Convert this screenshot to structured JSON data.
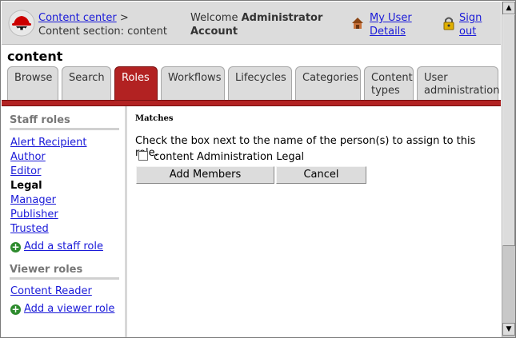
{
  "header": {
    "breadcrumb_link": "Content center",
    "breadcrumb_sep": ">",
    "breadcrumb_section": "Content section: content",
    "welcome_prefix": "Welcome",
    "welcome_user_line1": "Administrator",
    "welcome_user_line2": "Account",
    "my_details_line1": "My User",
    "my_details_line2": "Details",
    "signout_line1": "Sign",
    "signout_line2": "out"
  },
  "page": {
    "title": "content"
  },
  "tabs": [
    {
      "label1": "Browse",
      "label2": ""
    },
    {
      "label1": "Search",
      "label2": ""
    },
    {
      "label1": "Roles",
      "label2": "",
      "active": true
    },
    {
      "label1": "Workflows",
      "label2": ""
    },
    {
      "label1": "Lifecycles",
      "label2": ""
    },
    {
      "label1": "Categories",
      "label2": ""
    },
    {
      "label1": "Content",
      "label2": "types"
    },
    {
      "label1": "User",
      "label2": "administration"
    }
  ],
  "sidebar": {
    "staff_heading": "Staff roles",
    "staff_roles": [
      "Alert Recipient",
      "Author",
      "Editor",
      "Legal",
      "Manager",
      "Publisher",
      "Trusted"
    ],
    "current_role": "Legal",
    "add_staff": "Add a staff role",
    "viewer_heading": "Viewer roles",
    "viewer_roles": [
      "Content Reader"
    ],
    "add_viewer": "Add a viewer role"
  },
  "main": {
    "matches_heading": "Matches",
    "instructions": "Check the box next to the name of the person(s) to assign to this role.",
    "candidate": "content Administration Legal",
    "candidate_checked": false,
    "add_members_label": "Add Members",
    "cancel_label": "Cancel"
  },
  "colors": {
    "accent": "#b22222",
    "link": "#1a1ad8",
    "chrome": "#dcdcdc"
  }
}
